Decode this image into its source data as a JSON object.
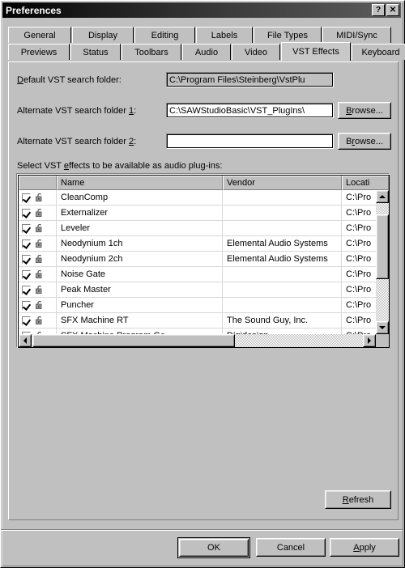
{
  "window": {
    "title": "Preferences",
    "help_button": "?",
    "close_button": "×"
  },
  "tabs": {
    "row1": [
      {
        "label": "General",
        "active": false
      },
      {
        "label": "Display",
        "active": false
      },
      {
        "label": "Editing",
        "active": false
      },
      {
        "label": "Labels",
        "active": false
      },
      {
        "label": "File Types",
        "active": false
      },
      {
        "label": "MIDI/Sync",
        "active": false
      }
    ],
    "row2": [
      {
        "label": "Previews",
        "active": false
      },
      {
        "label": "Status",
        "active": false
      },
      {
        "label": "Toolbars",
        "active": false
      },
      {
        "label": "Audio",
        "active": false
      },
      {
        "label": "Video",
        "active": false
      },
      {
        "label": "VST Effects",
        "active": true
      },
      {
        "label": "Keyboard",
        "active": false
      }
    ]
  },
  "form": {
    "default_folder": {
      "label_pre": "D",
      "label_accel": "e",
      "label_post": "fault VST search folder:",
      "value": "C:\\Program Files\\Steinberg\\VstPlu",
      "readonly": true
    },
    "alt_folder_1": {
      "label_pre": "Alternate VST search folder ",
      "label_accel": "1",
      "label_post": ":",
      "value": "C:\\SAWStudioBasic\\VST_PlugIns\\",
      "browse_pre": "B",
      "browse_accel": "B",
      "browse_label": "Browse..."
    },
    "alt_folder_2": {
      "label_pre": "Alternate VST search folder ",
      "label_accel": "2",
      "label_post": ":",
      "value": "",
      "browse_label": "Browse..."
    }
  },
  "list": {
    "caption_pre": "Select VST ",
    "caption_accel": "e",
    "caption_post": "ffects to be available as audio plug-ins:",
    "columns": [
      "",
      "Name",
      "Vendor",
      "Locati"
    ],
    "rows": [
      {
        "checked": true,
        "name": "CleanComp",
        "vendor": "",
        "location": "C:\\Pro"
      },
      {
        "checked": true,
        "name": "Externalizer",
        "vendor": "",
        "location": "C:\\Pro"
      },
      {
        "checked": true,
        "name": "Leveler",
        "vendor": "",
        "location": "C:\\Pro"
      },
      {
        "checked": true,
        "name": "Neodynium 1ch",
        "vendor": "Elemental Audio Systems",
        "location": "C:\\Pro"
      },
      {
        "checked": true,
        "name": "Neodynium 2ch",
        "vendor": "Elemental Audio Systems",
        "location": "C:\\Pro"
      },
      {
        "checked": true,
        "name": "Noise Gate",
        "vendor": "",
        "location": "C:\\Pro"
      },
      {
        "checked": true,
        "name": "Peak Master",
        "vendor": "",
        "location": "C:\\Pro"
      },
      {
        "checked": true,
        "name": "Puncher",
        "vendor": "",
        "location": "C:\\Pro"
      },
      {
        "checked": true,
        "name": "SFX Machine RT",
        "vendor": "The Sound Guy, Inc.",
        "location": "C:\\Pro"
      },
      {
        "checked": true,
        "name": "SFX Machine Program Ge",
        "vendor": "Digidesign",
        "location": "C:\\Pro"
      }
    ]
  },
  "refresh": {
    "label": "Refresh",
    "accel": "R"
  },
  "footer": {
    "ok": "OK",
    "cancel": "Cancel",
    "apply_pre": "A",
    "apply_accel": "A",
    "apply_label": "Apply"
  }
}
